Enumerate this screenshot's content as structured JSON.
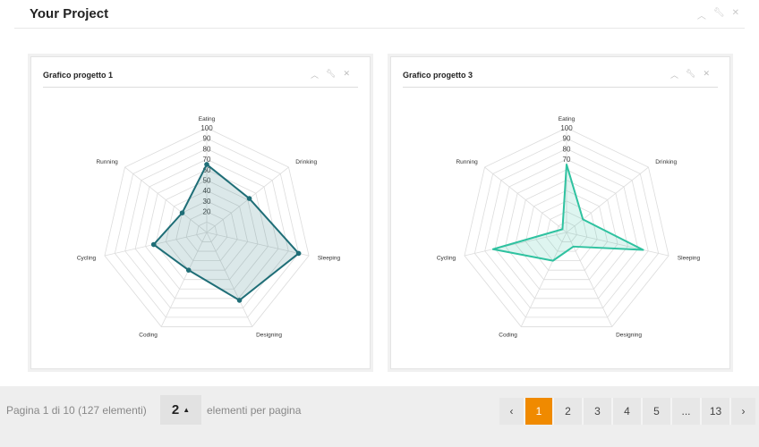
{
  "panel": {
    "title": "Your Project"
  },
  "axes": [
    "Eating",
    "Drinking",
    "Sleeping",
    "Designing",
    "Coding",
    "Cycling",
    "Running"
  ],
  "ticks": [
    "100",
    "90",
    "80",
    "70",
    "60",
    "50",
    "40",
    "30",
    "20"
  ],
  "colors": {
    "accent": "#f08a00",
    "series1": "#1f6e77",
    "series3": "#2fc2a0"
  },
  "chart_data": [
    {
      "type": "radar",
      "title": "Grafico progetto 1",
      "categories": [
        "Eating",
        "Drinking",
        "Sleeping",
        "Designing",
        "Coding",
        "Cycling",
        "Running"
      ],
      "values": [
        65,
        52,
        90,
        72,
        40,
        52,
        30
      ],
      "rmax": 100,
      "ticks": [
        20,
        30,
        40,
        50,
        60,
        70,
        80,
        90,
        100
      ],
      "grid": true
    },
    {
      "type": "radar",
      "title": "Grafico progetto 3",
      "categories": [
        "Eating",
        "Drinking",
        "Sleeping",
        "Designing",
        "Coding",
        "Cycling",
        "Running"
      ],
      "values": [
        65,
        20,
        75,
        15,
        30,
        72,
        5
      ],
      "rmax": 100,
      "ticks": [
        70,
        80,
        90,
        100
      ],
      "grid": true
    }
  ],
  "footer": {
    "info": "Pagina 1 di 10 (127 elementi)",
    "per_page_value": "2",
    "per_page_label": "elementi per pagina"
  },
  "pagination": {
    "prev": "‹",
    "next": "›",
    "pages": [
      "1",
      "2",
      "3",
      "4",
      "5",
      "...",
      "13"
    ],
    "current": "1"
  }
}
